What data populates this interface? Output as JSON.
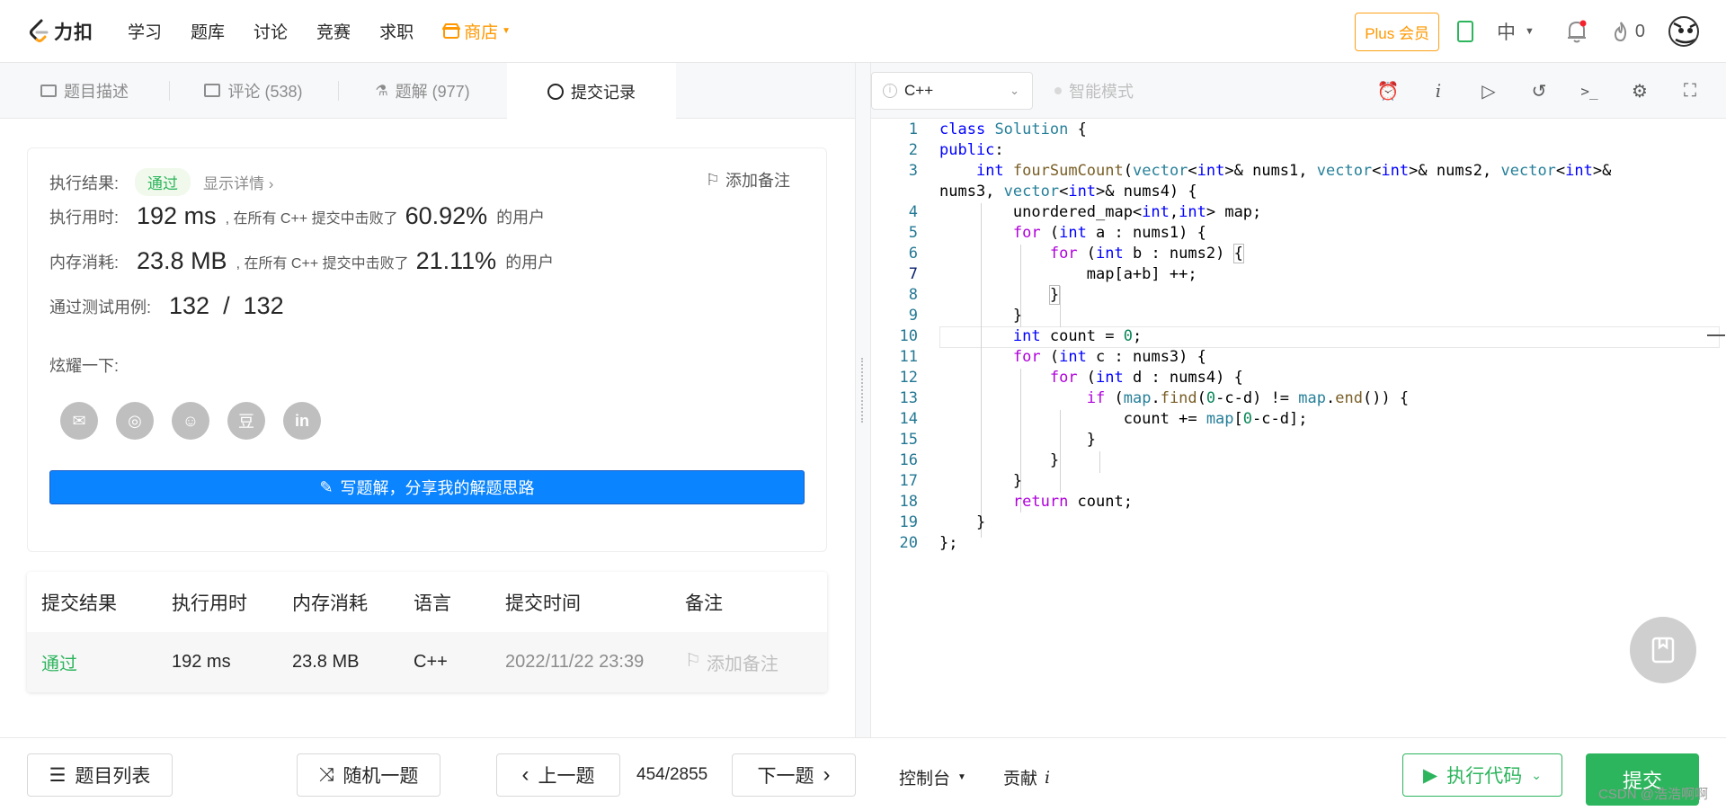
{
  "nav": {
    "logo_text": "力扣",
    "links": [
      "学习",
      "题库",
      "讨论",
      "竞赛",
      "求职"
    ],
    "shop": "商店",
    "plus": "Plus 会员",
    "lang": "中",
    "fire_count": "0"
  },
  "tabs": [
    {
      "label": "题目描述"
    },
    {
      "label": "评论 (538)"
    },
    {
      "label": "题解 (977)"
    },
    {
      "label": "提交记录"
    }
  ],
  "result": {
    "label": "执行结果:",
    "status": "通过",
    "details": "显示详情 ›",
    "add_note": "添加备注",
    "time_label": "执行用时:",
    "time_value": "192 ms",
    "time_text": ", 在所有 C++ 提交中击败了",
    "time_pct": "60.92%",
    "users": "的用户",
    "mem_label": "内存消耗:",
    "mem_value": "23.8 MB",
    "mem_text": ", 在所有 C++ 提交中击败了",
    "mem_pct": "21.11%",
    "cases_label": "通过测试用例:",
    "cases_value": "132  /  132",
    "share_label": "炫耀一下:",
    "write_btn": "写题解，分享我的解题思路"
  },
  "submissions": {
    "headers": [
      "提交结果",
      "执行用时",
      "内存消耗",
      "语言",
      "提交时间",
      "备注"
    ],
    "row": {
      "result": "通过",
      "time": "192 ms",
      "memory": "23.8 MB",
      "lang": "C++",
      "submitted": "2022/11/22 23:39",
      "note": "添加备注"
    }
  },
  "editor": {
    "language": "C++",
    "smart_mode": "智能模式",
    "line_numbers": [
      "1",
      "2",
      "3",
      "4",
      "5",
      "6",
      "7",
      "8",
      "9",
      "10",
      "11",
      "12",
      "13",
      "14",
      "15",
      "16",
      "17",
      "18",
      "19",
      "20"
    ]
  },
  "bottom": {
    "problem_list": "题目列表",
    "random": "随机一题",
    "prev": "上一题",
    "page": "454/2855",
    "next": "下一题",
    "console": "控制台",
    "contribute": "贡献",
    "run": "执行代码",
    "submit": "提交",
    "watermark": "CSDN @浩浩啊啊"
  },
  "colors": {
    "accent_green": "#2db55d",
    "blue_button": "#0a84ff",
    "shop_orange": "#ff9800"
  }
}
